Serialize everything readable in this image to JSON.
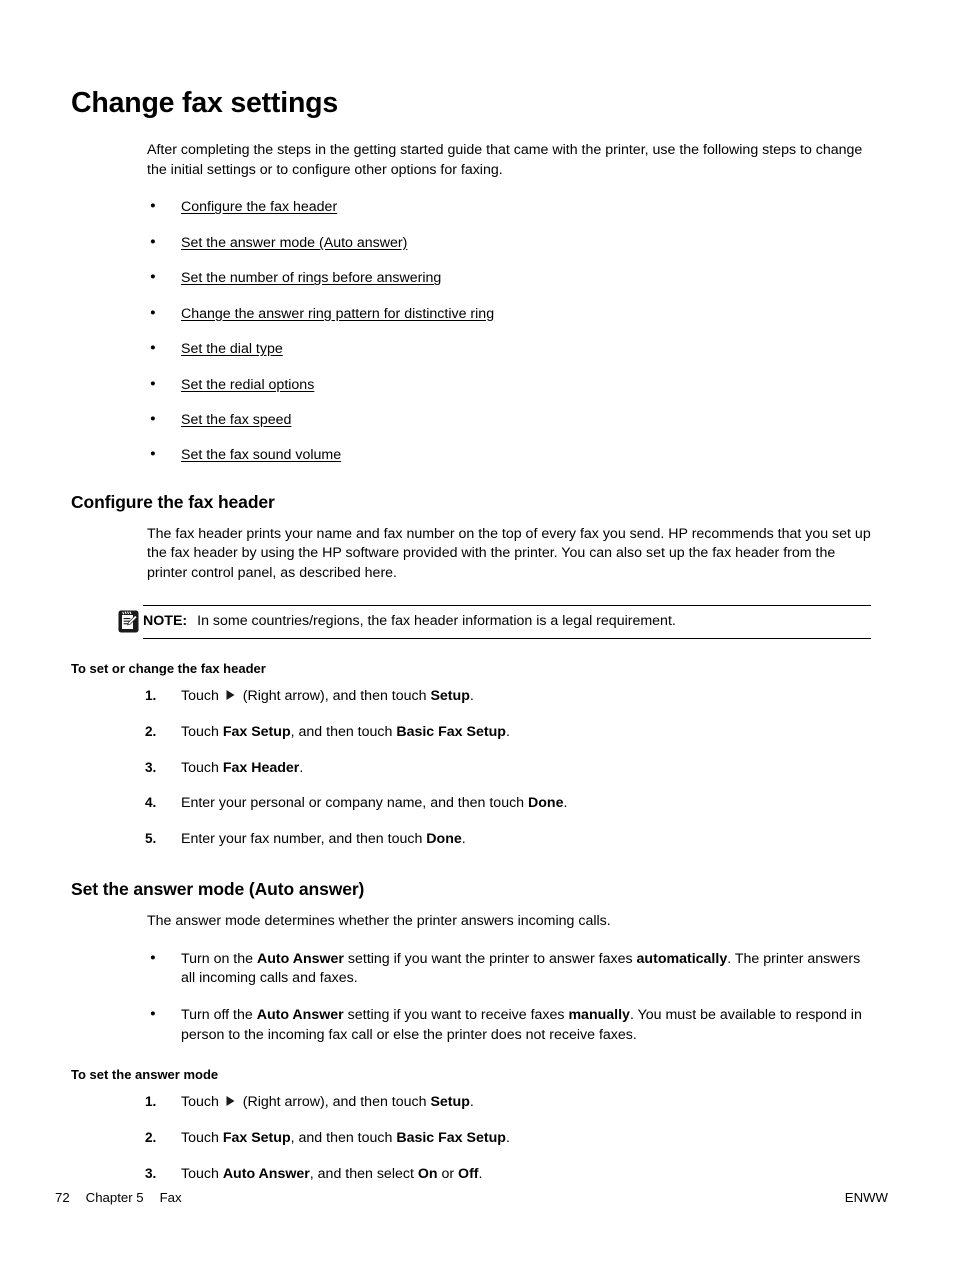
{
  "page": {
    "title": "Change fax settings",
    "intro": "After completing the steps in the getting started guide that came with the printer, use the following steps to change the initial settings or to configure other options for faxing."
  },
  "toc_links": [
    {
      "label": "Configure the fax header"
    },
    {
      "label": "Set the answer mode (Auto answer)"
    },
    {
      "label": "Set the number of rings before answering"
    },
    {
      "label": "Change the answer ring pattern for distinctive ring"
    },
    {
      "label": "Set the dial type"
    },
    {
      "label": "Set the redial options"
    },
    {
      "label": "Set the fax speed"
    },
    {
      "label": "Set the fax sound volume"
    }
  ],
  "section_fax_header": {
    "heading": "Configure the fax header",
    "body": "The fax header prints your name and fax number on the top of every fax you send. HP recommends that you set up the fax header by using the HP software provided with the printer. You can also set up the fax header from the printer control panel, as described here.",
    "note": {
      "icon": "note-pencil-icon",
      "label": "NOTE:",
      "text": "In some countries/regions, the fax header information is a legal requirement."
    },
    "procedure_title": "To set or change the fax header",
    "steps": [
      {
        "num": "1.",
        "pre": "Touch ",
        "icon": "right-arrow-icon",
        "mid": " (Right arrow), and then touch ",
        "bold1": "Setup",
        "post": "."
      },
      {
        "num": "2.",
        "pre": "Touch ",
        "bold1": "Fax Setup",
        "mid": ", and then touch ",
        "bold2": "Basic Fax Setup",
        "post": "."
      },
      {
        "num": "3.",
        "pre": "Touch ",
        "bold1": "Fax Header",
        "post": "."
      },
      {
        "num": "4.",
        "pre": "Enter your personal or company name, and then touch ",
        "bold1": "Done",
        "post": "."
      },
      {
        "num": "5.",
        "pre": "Enter your fax number, and then touch ",
        "bold1": "Done",
        "post": "."
      }
    ]
  },
  "section_answer_mode": {
    "heading": "Set the answer mode (Auto answer)",
    "body": "The answer mode determines whether the printer answers incoming calls.",
    "bullets": [
      {
        "pre": "Turn on the ",
        "bold1": "Auto Answer",
        "mid": " setting if you want the printer to answer faxes ",
        "bold2": "automatically",
        "post": ". The printer answers all incoming calls and faxes."
      },
      {
        "pre": "Turn off the ",
        "bold1": "Auto Answer",
        "mid": " setting if you want to receive faxes ",
        "bold2": "manually",
        "post": ". You must be available to respond in person to the incoming fax call or else the printer does not receive faxes."
      }
    ],
    "procedure_title": "To set the answer mode",
    "steps": [
      {
        "num": "1.",
        "pre": "Touch ",
        "icon": "right-arrow-icon",
        "mid": " (Right arrow), and then touch ",
        "bold1": "Setup",
        "post": "."
      },
      {
        "num": "2.",
        "pre": "Touch ",
        "bold1": "Fax Setup",
        "mid": ", and then touch ",
        "bold2": "Basic Fax Setup",
        "post": "."
      },
      {
        "num": "3.",
        "pre": "Touch ",
        "bold1": "Auto Answer",
        "mid": ", and then select ",
        "bold2": "On",
        "mid2": " or ",
        "bold3": "Off",
        "post": "."
      }
    ]
  },
  "footer": {
    "page_number": "72",
    "chapter": "Chapter 5",
    "chapter_name": "Fax",
    "locale": "ENWW"
  }
}
